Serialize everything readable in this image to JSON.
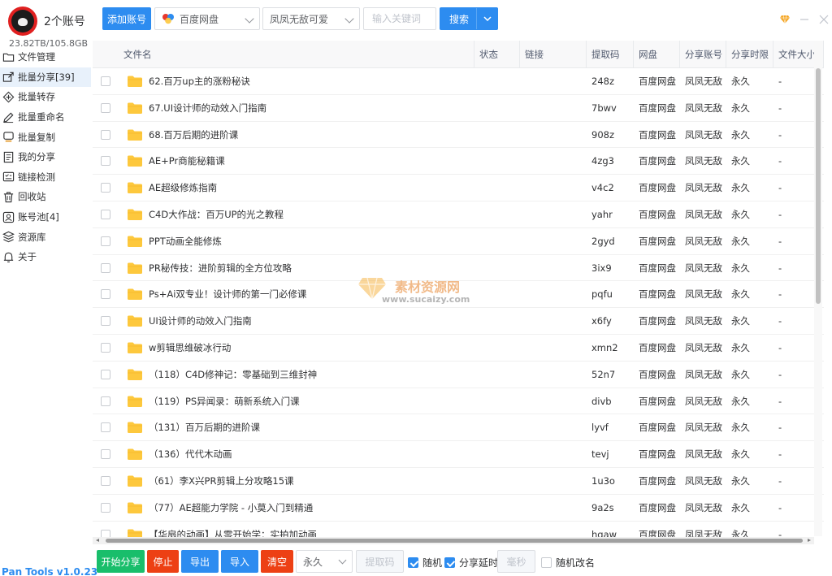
{
  "account": {
    "name": "2个账号",
    "quota": "23.82TB/105.8GB"
  },
  "sidebar": {
    "items": [
      {
        "label": "文件管理",
        "icon": "folder-icon",
        "active": false
      },
      {
        "label": "批量分享[39]",
        "icon": "share-icon",
        "active": true
      },
      {
        "label": "批量转存",
        "icon": "transfer-icon",
        "active": false
      },
      {
        "label": "批量重命名",
        "icon": "edit-icon",
        "active": false
      },
      {
        "label": "批量复制",
        "icon": "copy-icon",
        "active": false
      },
      {
        "label": "我的分享",
        "icon": "document-icon",
        "active": false
      },
      {
        "label": "链接检测",
        "icon": "check-icon",
        "active": false
      },
      {
        "label": "回收站",
        "icon": "trash-icon",
        "active": false
      },
      {
        "label": "账号池[4]",
        "icon": "account-pool-icon",
        "active": false
      },
      {
        "label": "资源库",
        "icon": "library-icon",
        "active": false
      },
      {
        "label": "关于",
        "icon": "bell-icon",
        "active": false
      }
    ],
    "version": "Pan Tools v1.0.23"
  },
  "toolbar": {
    "add_account": "添加账号",
    "pan_select": "百度网盘",
    "account_select": "凤凤无敌可爱",
    "keyword_placeholder": "输入关键词",
    "search": "搜索"
  },
  "table": {
    "headers": [
      "文件名",
      "状态",
      "链接",
      "提取码",
      "网盘",
      "分享账号",
      "分享时限",
      "文件大小"
    ],
    "rows": [
      {
        "name": "62.百万up主的涨粉秘诀",
        "status": "",
        "link": "",
        "code": "248z",
        "pan": "百度网盘",
        "account": "凤凤无敌",
        "limit": "永久",
        "size": "-"
      },
      {
        "name": "67.UI设计师的动效入门指南",
        "status": "",
        "link": "",
        "code": "7bwv",
        "pan": "百度网盘",
        "account": "凤凤无敌",
        "limit": "永久",
        "size": "-"
      },
      {
        "name": "68.百万后期的进阶课",
        "status": "",
        "link": "",
        "code": "908z",
        "pan": "百度网盘",
        "account": "凤凤无敌",
        "limit": "永久",
        "size": "-"
      },
      {
        "name": "AE+Pr商能秘籍课",
        "status": "",
        "link": "",
        "code": "4zg3",
        "pan": "百度网盘",
        "account": "凤凤无敌",
        "limit": "永久",
        "size": "-"
      },
      {
        "name": "AE超级修炼指南",
        "status": "",
        "link": "",
        "code": "v4c2",
        "pan": "百度网盘",
        "account": "凤凤无敌",
        "limit": "永久",
        "size": "-"
      },
      {
        "name": "C4D大作战：百万UP的光之教程",
        "status": "",
        "link": "",
        "code": "yahr",
        "pan": "百度网盘",
        "account": "凤凤无敌",
        "limit": "永久",
        "size": "-"
      },
      {
        "name": "PPT动画全能修炼",
        "status": "",
        "link": "",
        "code": "2gyd",
        "pan": "百度网盘",
        "account": "凤凤无敌",
        "limit": "永久",
        "size": "-"
      },
      {
        "name": "PR秘传技：进阶剪辑的全方位攻略",
        "status": "",
        "link": "",
        "code": "3ix9",
        "pan": "百度网盘",
        "account": "凤凤无敌",
        "limit": "永久",
        "size": "-"
      },
      {
        "name": "Ps+Ai双专业！设计师的第一门必修课",
        "status": "",
        "link": "",
        "code": "pqfu",
        "pan": "百度网盘",
        "account": "凤凤无敌",
        "limit": "永久",
        "size": "-"
      },
      {
        "name": "UI设计师的动效入门指南",
        "status": "",
        "link": "",
        "code": "x6fy",
        "pan": "百度网盘",
        "account": "凤凤无敌",
        "limit": "永久",
        "size": "-"
      },
      {
        "name": "w剪辑思维破冰行动",
        "status": "",
        "link": "",
        "code": "xmn2",
        "pan": "百度网盘",
        "account": "凤凤无敌",
        "limit": "永久",
        "size": "-"
      },
      {
        "name": "（118）C4D修神记：零基础到三维封神",
        "status": "",
        "link": "",
        "code": "52n7",
        "pan": "百度网盘",
        "account": "凤凤无敌",
        "limit": "永久",
        "size": "-"
      },
      {
        "name": "（119）PS异闻录：萌新系统入门课",
        "status": "",
        "link": "",
        "code": "divb",
        "pan": "百度网盘",
        "account": "凤凤无敌",
        "limit": "永久",
        "size": "-"
      },
      {
        "name": "（131）百万后期的进阶课",
        "status": "",
        "link": "",
        "code": "lyvf",
        "pan": "百度网盘",
        "account": "凤凤无敌",
        "limit": "永久",
        "size": "-"
      },
      {
        "name": "（136）代代木动画",
        "status": "",
        "link": "",
        "code": "tevj",
        "pan": "百度网盘",
        "account": "凤凤无敌",
        "limit": "永久",
        "size": "-"
      },
      {
        "name": "（61）李X兴PR剪辑上分攻略15课",
        "status": "",
        "link": "",
        "code": "1u3o",
        "pan": "百度网盘",
        "account": "凤凤无敌",
        "limit": "永久",
        "size": "-"
      },
      {
        "name": "（77）AE超能力学院 - 小莫入门到精通",
        "status": "",
        "link": "",
        "code": "9a2s",
        "pan": "百度网盘",
        "account": "凤凤无敌",
        "limit": "永久",
        "size": "-"
      },
      {
        "name": "【华扇的动画】从零开始学：实拍加动画",
        "status": "",
        "link": "",
        "code": "hgaw",
        "pan": "百度网盘",
        "account": "凤凤无敌",
        "limit": "永久",
        "size": "-"
      }
    ]
  },
  "watermark": {
    "title": "素材资源网",
    "url": "www.sucaizy.com"
  },
  "bottom": {
    "start_share": "开始分享",
    "stop": "停止",
    "export": "导出",
    "import": "导入",
    "clear": "清空",
    "limit_select": "永久",
    "code_placeholder": "提取码",
    "random_label": "随机",
    "random_checked": true,
    "delay_label": "分享延时",
    "delay_checked": true,
    "ms_placeholder": "毫秒",
    "rename_label": "随机改名",
    "rename_checked": false
  },
  "colors": {
    "primary": "#2d8cf0",
    "success": "#19be6b",
    "danger": "#ed4014",
    "folder": "#fdc83d",
    "active_bg": "#e8f1fb"
  }
}
